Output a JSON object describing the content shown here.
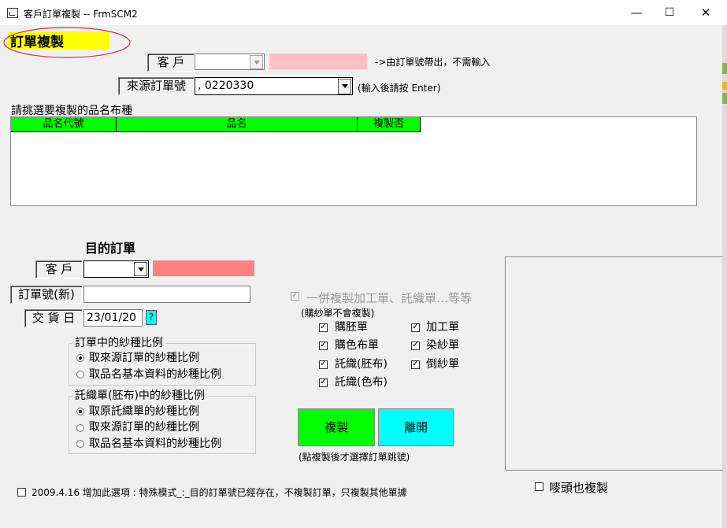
{
  "window": {
    "title": "客戶訂單複製 -- FrmSCM2",
    "minimize": "—",
    "maximize": "☐",
    "close": "✕"
  },
  "header": {
    "title": "訂單複製"
  },
  "source": {
    "customer_label": "客  戶",
    "customer_hint": "->由訂單號帶出，不需輸入",
    "order_label": "來源訂單號",
    "order_value": ",  0220330",
    "order_hint": "(輸入後請按 Enter)",
    "grid_caption": "請挑選要複製的品名布種",
    "grid_columns": [
      "品名代號",
      "品名",
      "複製否"
    ]
  },
  "target": {
    "heading": "目的訂單",
    "customer_label": "客  戶",
    "order_label": "訂單號(新)",
    "delivery_label": "交 貨 日",
    "delivery_value": "23/01/20",
    "help_label": "?"
  },
  "yarn_ratio_group": {
    "title": "訂單中的紗種比例",
    "options": [
      "取來源訂單的紗種比例",
      "取品名基本資料的紗種比例"
    ],
    "selected": 0
  },
  "weaving_group": {
    "title": "託織單(胚布)中的紗種比例",
    "options": [
      "取原託織單的紗種比例",
      "取來源訂單的紗種比例",
      "取品名基本資料的紗種比例"
    ],
    "selected": 0
  },
  "copy_options": {
    "main_label": "一併複製加工單、託織單…等等",
    "note": "(購紗單不會複製)",
    "items": [
      {
        "label": "購胚單",
        "checked": true
      },
      {
        "label": "加工單",
        "checked": true
      },
      {
        "label": "購色布單",
        "checked": true
      },
      {
        "label": "染紗單",
        "checked": true
      },
      {
        "label": "託織(胚布)",
        "checked": true
      },
      {
        "label": "倒紗單",
        "checked": true
      },
      {
        "label": "託織(色布)",
        "checked": true
      }
    ]
  },
  "buttons": {
    "copy": "複製",
    "leave": "離開",
    "note": "(點複製後才選擇訂單跳號)"
  },
  "footer": {
    "special_mode": "2009.4.16 增加此選項 : 特殊模式_:_目的訂單號已經存在，不複製訂單，只複製其他單據",
    "head_copy": "嘜頭也複製"
  },
  "colors": {
    "highlight_yellow": "#ffff00",
    "annotation_red": "#d0303a",
    "pink": "#ffc0c0",
    "salmon": "#ff8080",
    "green": "#00ff00",
    "cyan": "#00ffff"
  }
}
